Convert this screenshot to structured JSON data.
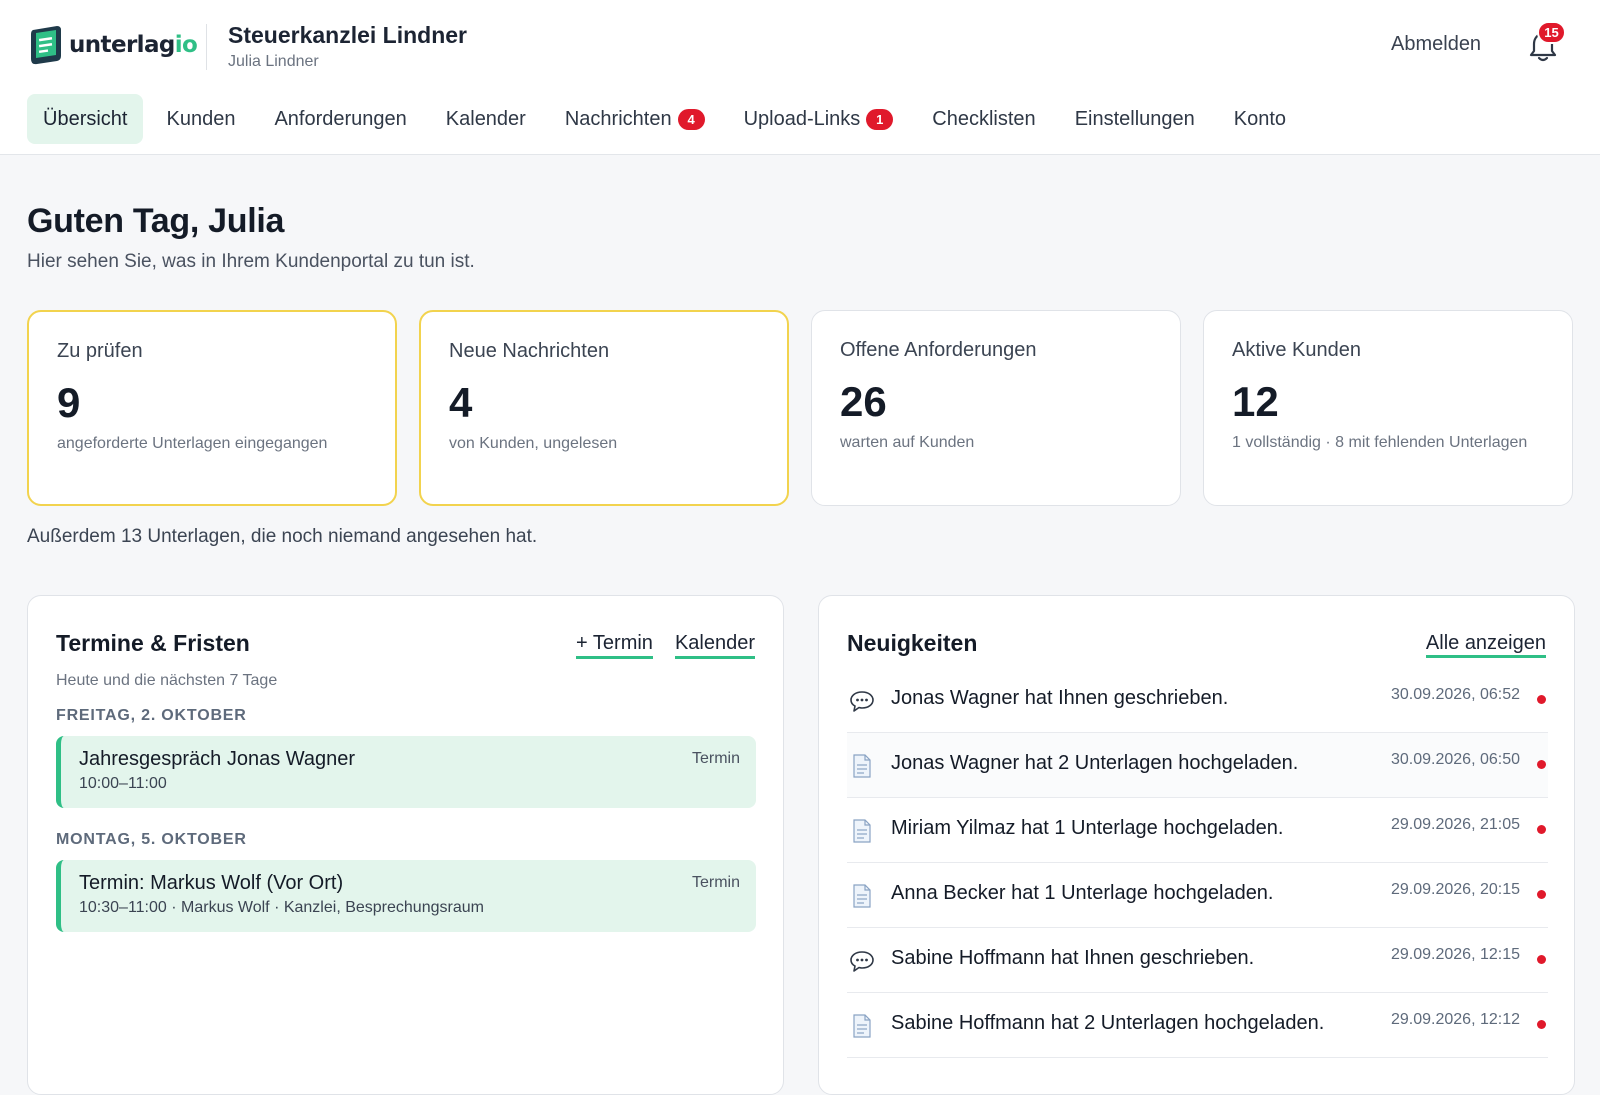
{
  "brand": {
    "name_main": "unterlag",
    "name_accent": "io",
    "accent_color": "#2fbf86"
  },
  "org": {
    "name": "Steuerkanzlei Lindner",
    "user": "Julia Lindner"
  },
  "header": {
    "logout_label": "Abmelden",
    "notifications_count": "15"
  },
  "nav": {
    "items": [
      {
        "label": "Übersicht"
      },
      {
        "label": "Kunden"
      },
      {
        "label": "Anforderungen"
      },
      {
        "label": "Kalender"
      },
      {
        "label": "Nachrichten",
        "badge": "4"
      },
      {
        "label": "Upload-Links",
        "badge": "1"
      },
      {
        "label": "Checklisten"
      },
      {
        "label": "Einstellungen"
      },
      {
        "label": "Konto"
      }
    ]
  },
  "main": {
    "greeting": "Guten Tag, Julia",
    "subtitle": "Hier sehen Sie, was in Ihrem Kundenportal zu tun ist.",
    "footnote": "Außerdem 13 Unterlagen, die noch niemand angesehen hat."
  },
  "stats": [
    {
      "label": "Zu prüfen",
      "value": "9",
      "desc": "angeforderte Unterlagen eingegangen"
    },
    {
      "label": "Neue Nachrichten",
      "value": "4",
      "desc": "von Kunden, ungelesen"
    },
    {
      "label": "Offene Anforderungen",
      "value": "26",
      "desc": "warten auf Kunden"
    },
    {
      "label": "Aktive Kunden",
      "value": "12",
      "desc": "1 vollständig · 8 mit fehlenden Unterlagen"
    }
  ],
  "deadlines": {
    "title": "Termine & Fristen",
    "subtitle": "Heute und die nächsten 7 Tage",
    "add_link": "+ Termin",
    "calendar_link": "Kalender",
    "days": [
      {
        "label": "FREITAG, 2. OKTOBER",
        "event": {
          "title": "Jahresgespräch Jonas Wagner",
          "meta": "10:00–11:00",
          "tag": "Termin"
        }
      },
      {
        "label": "MONTAG, 5. OKTOBER",
        "event": {
          "title": "Termin: Markus Wolf (Vor Ort)",
          "meta": "10:30–11:00 · Markus Wolf · Kanzlei, Besprechungsraum",
          "tag": "Termin"
        }
      }
    ]
  },
  "news": {
    "title": "Neuigkeiten",
    "all_link": "Alle anzeigen",
    "items": [
      {
        "icon": "speech-bubble-icon",
        "text": "Jonas Wagner hat Ihnen geschrieben.",
        "time": "30.09.2026, 06:52"
      },
      {
        "icon": "document-icon",
        "text": "Jonas Wagner hat 2 Unterlagen hochgeladen.",
        "time": "30.09.2026, 06:50"
      },
      {
        "icon": "document-icon",
        "text": "Miriam Yilmaz hat 1 Unterlage hochgeladen.",
        "time": "29.09.2026, 21:05"
      },
      {
        "icon": "document-icon",
        "text": "Anna Becker hat 1 Unterlage hochgeladen.",
        "time": "29.09.2026, 20:15"
      },
      {
        "icon": "speech-bubble-icon",
        "text": "Sabine Hoffmann hat Ihnen geschrieben.",
        "time": "29.09.2026, 12:15"
      },
      {
        "icon": "document-icon",
        "text": "Sabine Hoffmann hat 2 Unterlagen hochgeladen.",
        "time": "29.09.2026, 12:12"
      }
    ]
  }
}
